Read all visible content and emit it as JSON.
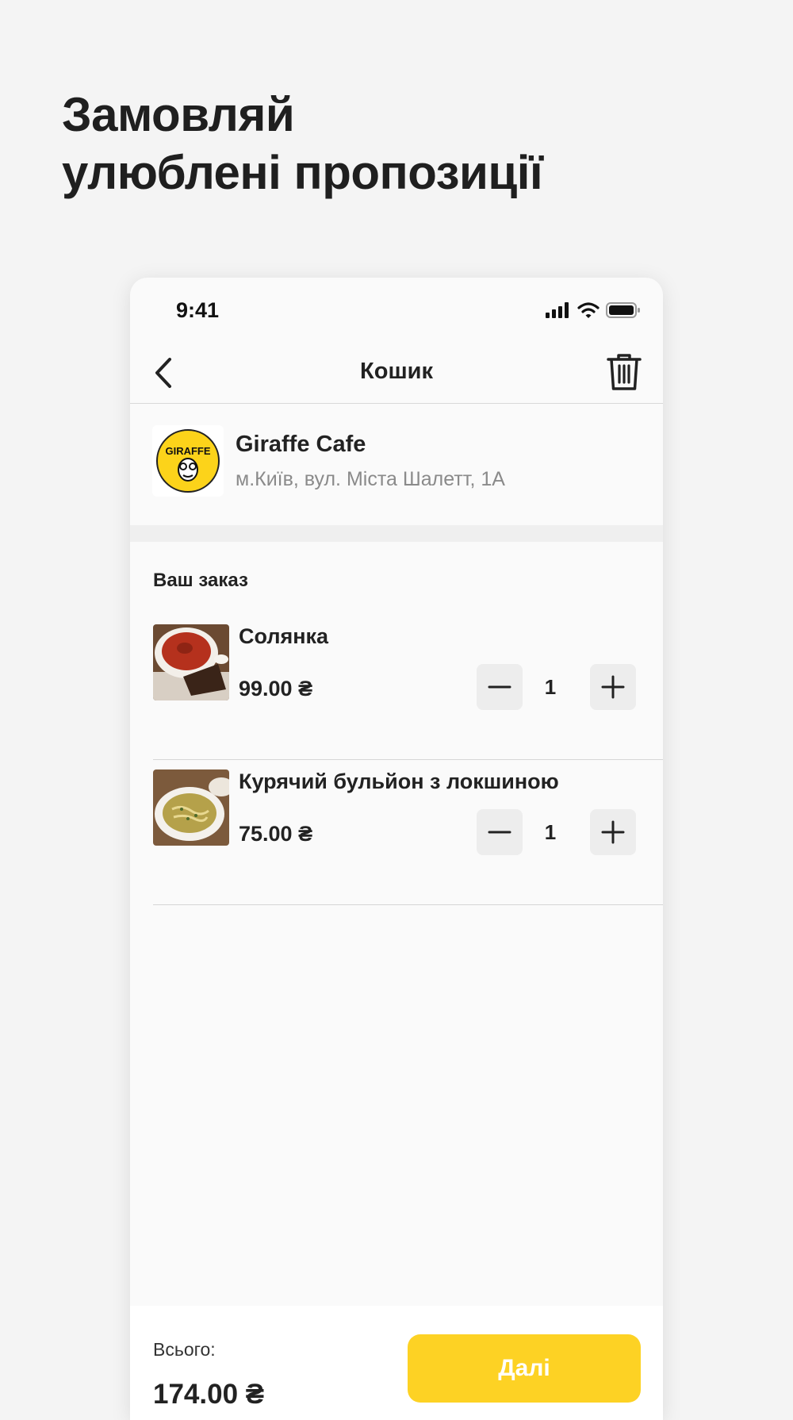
{
  "headline": {
    "line1": "Замовляй",
    "line2": "улюблені пропозиції"
  },
  "status_bar": {
    "time": "9:41"
  },
  "nav": {
    "title": "Кошик"
  },
  "cafe": {
    "name": "Giraffe Cafe",
    "address": "м.Київ, вул. Міста Шалетт, 1A",
    "logo_text": "GIRAFFE"
  },
  "order": {
    "title": "Ваш заказ",
    "items": [
      {
        "name": "Солянка",
        "price": "99.00 ₴",
        "quantity": "1"
      },
      {
        "name": "Курячий бульйон з локшиною",
        "price": "75.00 ₴",
        "quantity": "1"
      }
    ]
  },
  "footer": {
    "total_label": "Всього:",
    "total_value": "174.00 ₴",
    "next_label": "Далі"
  },
  "colors": {
    "accent": "#fdd224",
    "background": "#f4f4f4"
  }
}
